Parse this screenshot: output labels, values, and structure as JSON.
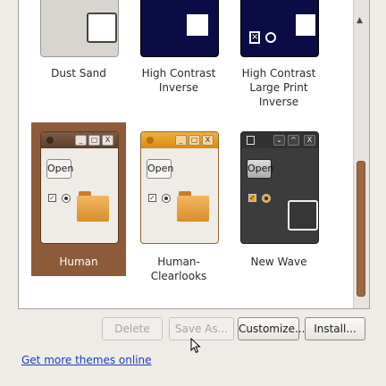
{
  "themes": [
    {
      "name": "Dust Sand",
      "selected": false
    },
    {
      "name": "High Contrast Inverse",
      "selected": false
    },
    {
      "name": "High Contrast Large Print Inverse",
      "selected": false
    },
    {
      "name": "Human",
      "selected": true
    },
    {
      "name": "Human-Clearlooks",
      "selected": false
    },
    {
      "name": "New Wave",
      "selected": false
    }
  ],
  "previews": {
    "open_label": "Open",
    "checkbox_mark": "✓",
    "window_buttons": [
      "_",
      "▢",
      "X"
    ],
    "new_wave_buttons": [
      "⌄",
      "^",
      "X"
    ]
  },
  "buttons": {
    "delete": "Delete",
    "save_as": "Save As...",
    "customize": "Customize...",
    "install": "Install..."
  },
  "link": "Get more themes online",
  "colors": {
    "selection": "#8e5b3a",
    "scrollbar_thumb": "#9b6842",
    "link": "#1a3fb5"
  }
}
